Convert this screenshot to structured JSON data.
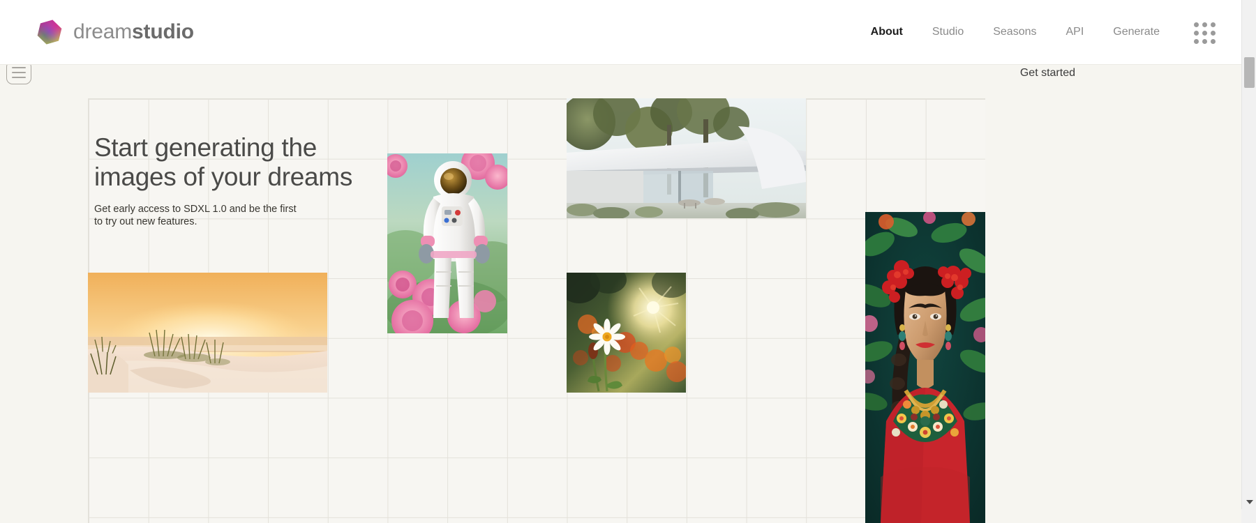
{
  "brand": {
    "word1": "dream",
    "word2": "studio",
    "logo_icon": "hexagon-gradient-icon"
  },
  "nav": {
    "items": [
      {
        "label": "About",
        "active": true
      },
      {
        "label": "Studio",
        "active": false
      },
      {
        "label": "Seasons",
        "active": false
      },
      {
        "label": "API",
        "active": false
      },
      {
        "label": "Generate",
        "active": false
      }
    ],
    "apps_icon": "apps-grid-icon"
  },
  "toolbar": {
    "menu_icon": "hamburger-icon",
    "get_started_label": "Get started"
  },
  "hero": {
    "heading_line1": "Start generating the",
    "heading_line2": "images of your dreams",
    "subtext": "Get early access to SDXL 1.0 and be the first to try out new features."
  },
  "gallery": {
    "tiles": [
      {
        "name": "astronaut-roses-image",
        "alt": "Astronaut in a spacesuit surrounded by pink roses in a green garden"
      },
      {
        "name": "modern-architecture-image",
        "alt": "White curved modern architecture pavilion among trees"
      },
      {
        "name": "beach-dunes-sunset-image",
        "alt": "Sand dunes with beach grass at sunset over the ocean"
      },
      {
        "name": "daisy-meadow-image",
        "alt": "White daisy in a meadow of orange flowers backlit by the sun"
      },
      {
        "name": "frida-portrait-image",
        "alt": "Portrait of a woman with red flowers in her hair and embroidered floral dress"
      }
    ]
  },
  "colors": {
    "page_background": "#f6f5f0",
    "canvas_background": "#f7f6f2",
    "grid_line": "#e3e1da",
    "nav_active": "#1c1c1c",
    "nav_inactive": "#8a8a8a",
    "heading": "#4a4a48",
    "body_text": "#37352f"
  },
  "scrollbar": {
    "vertical_name": "vertical-scrollbar",
    "down_arrow_icon": "chevron-down-icon"
  }
}
